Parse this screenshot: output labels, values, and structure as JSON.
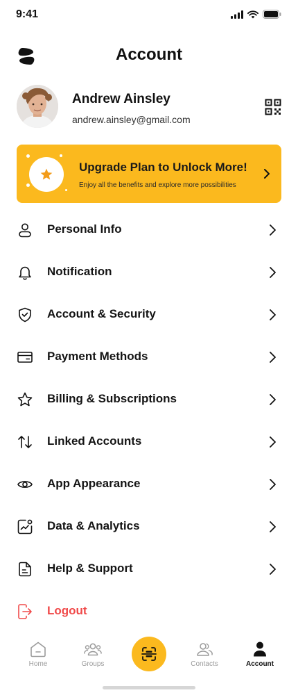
{
  "status_bar": {
    "time": "9:41"
  },
  "header": {
    "title": "Account"
  },
  "profile": {
    "name": "Andrew Ainsley",
    "email": "andrew.ainsley@gmail.com"
  },
  "upgrade": {
    "title": "Upgrade Plan to Unlock More!",
    "subtitle": "Enjoy all the benefits and explore more possibilities"
  },
  "menu": {
    "items": [
      {
        "label": "Personal Info",
        "icon": "user-icon"
      },
      {
        "label": "Notification",
        "icon": "bell-icon"
      },
      {
        "label": "Account & Security",
        "icon": "shield-icon"
      },
      {
        "label": "Payment Methods",
        "icon": "card-icon"
      },
      {
        "label": "Billing & Subscriptions",
        "icon": "star-icon"
      },
      {
        "label": "Linked Accounts",
        "icon": "arrows-icon"
      },
      {
        "label": "App Appearance",
        "icon": "eye-icon"
      },
      {
        "label": "Data & Analytics",
        "icon": "analytics-icon"
      },
      {
        "label": "Help & Support",
        "icon": "document-icon"
      }
    ],
    "logout": {
      "label": "Logout",
      "icon": "logout-icon"
    }
  },
  "bottom_nav": {
    "items": [
      {
        "label": "Home",
        "icon": "home-icon"
      },
      {
        "label": "Groups",
        "icon": "groups-icon"
      },
      {
        "label": "Contacts",
        "icon": "contacts-icon"
      },
      {
        "label": "Account",
        "icon": "account-icon"
      }
    ],
    "active": "Account"
  },
  "colors": {
    "accent": "#fbb91e",
    "danger": "#f04a4a",
    "text": "#141414",
    "muted": "#9a9a9a"
  }
}
